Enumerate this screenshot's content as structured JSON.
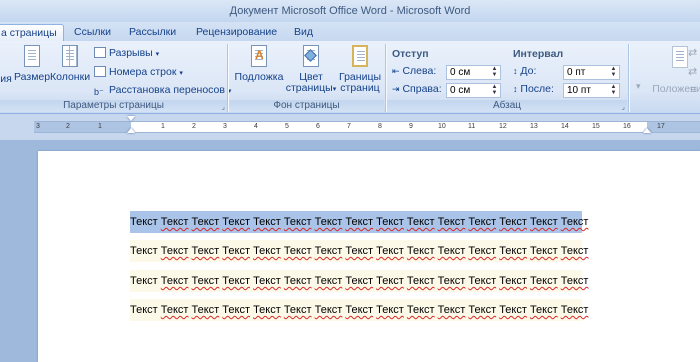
{
  "window": {
    "title": "Документ Microsoft Office Word - Microsoft Word"
  },
  "tabs": [
    {
      "label": "а страницы",
      "active": true
    },
    {
      "label": "Ссылки"
    },
    {
      "label": "Рассылки"
    },
    {
      "label": "Рецензирование"
    },
    {
      "label": "Вид"
    }
  ],
  "ribbon": {
    "page_setup": {
      "label": "Параметры страницы",
      "orientation_partial": "ия",
      "size": "Размер",
      "columns": "Колонки",
      "breaks": "Разрывы",
      "line_numbers": "Номера строк",
      "hyphenation": "Расстановка переносов"
    },
    "page_background": {
      "label": "Фон страницы",
      "watermark": "Подложка",
      "page_color_line1": "Цвет",
      "page_color_line2": "страницы",
      "page_borders_line1": "Границы",
      "page_borders_line2": "страниц"
    },
    "paragraph": {
      "label": "Абзац",
      "indent_title": "Отступ",
      "left_label": "Слева:",
      "left_value": "0 см",
      "right_label": "Справа:",
      "right_value": "0 см",
      "spacing_title": "Интервал",
      "before_label": "До:",
      "before_value": "0 пт",
      "after_label": "После:",
      "after_value": "10 пт"
    },
    "arrange": {
      "position": "Положение"
    }
  },
  "ruler": {
    "ticks": [
      "3",
      "2",
      "1",
      "1",
      "2",
      "3",
      "4",
      "5",
      "6",
      "7",
      "8",
      "9",
      "10",
      "11",
      "12",
      "13",
      "14",
      "15",
      "16",
      "17"
    ]
  },
  "document": {
    "word": "Текст",
    "paragraphs": [
      {
        "text": "Текст Текст Текст Текст Текст Текст Текст Текст Текст Текст Текст Текст Текст Текст Текст",
        "selected": true
      },
      {
        "text": "Текст Текст Текст Текст Текст Текст Текст Текст Текст Текст Текст Текст Текст Текст Текст",
        "selected": false
      },
      {
        "text": "Текст Текст Текст Текст Текст Текст Текст Текст Текст Текст Текст Текст Текст Текст Текст",
        "selected": false
      },
      {
        "text": "Текст Текст Текст Текст Текст Текст Текст Текст Текст Текст Текст Текст Текст Текст Текст",
        "selected": false
      }
    ]
  },
  "colors": {
    "selection": "#a9c4e8",
    "ribbon_text": "#15428b",
    "spell_underline": "#d62828"
  }
}
